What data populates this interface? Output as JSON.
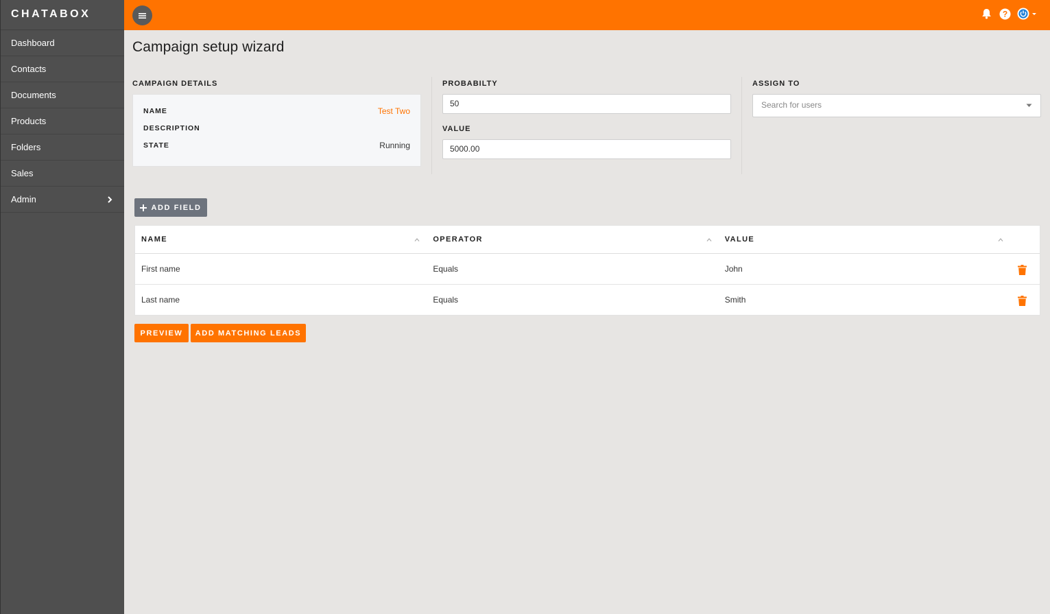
{
  "app": {
    "brand": "CHATABOX"
  },
  "sidebar": {
    "items": [
      {
        "label": "Dashboard"
      },
      {
        "label": "Contacts"
      },
      {
        "label": "Documents"
      },
      {
        "label": "Products"
      },
      {
        "label": "Folders"
      },
      {
        "label": "Sales"
      },
      {
        "label": "Admin",
        "has_submenu": true
      }
    ]
  },
  "topbar": {
    "icons": [
      "menu-icon",
      "bell-icon",
      "help-icon",
      "power-icon",
      "caret-down-icon"
    ],
    "accent_color": "#ff7300"
  },
  "page": {
    "title": "Campaign setup wizard"
  },
  "campaign_details": {
    "label": "CAMPAIGN DETAILS",
    "rows": [
      {
        "key": "NAME",
        "value": "Test Two"
      },
      {
        "key": "DESCRIPTION",
        "value": ""
      },
      {
        "key": "STATE",
        "value": "Running"
      }
    ]
  },
  "probability": {
    "label": "PROBABILTY",
    "value": "50"
  },
  "value_field": {
    "label": "VALUE",
    "value": "5000.00"
  },
  "assign_to": {
    "label": "ASSIGN TO",
    "placeholder": "Search for users"
  },
  "buttons": {
    "add_field": "ADD FIELD",
    "preview": "PREVIEW",
    "add_matching_leads": "ADD MATCHING LEADS"
  },
  "table": {
    "headers": [
      "NAME",
      "OPERATOR",
      "VALUE"
    ],
    "rows": [
      {
        "name": "First name",
        "operator": "Equals",
        "value": "John"
      },
      {
        "name": "Last name",
        "operator": "Equals",
        "value": "Smith"
      }
    ]
  }
}
